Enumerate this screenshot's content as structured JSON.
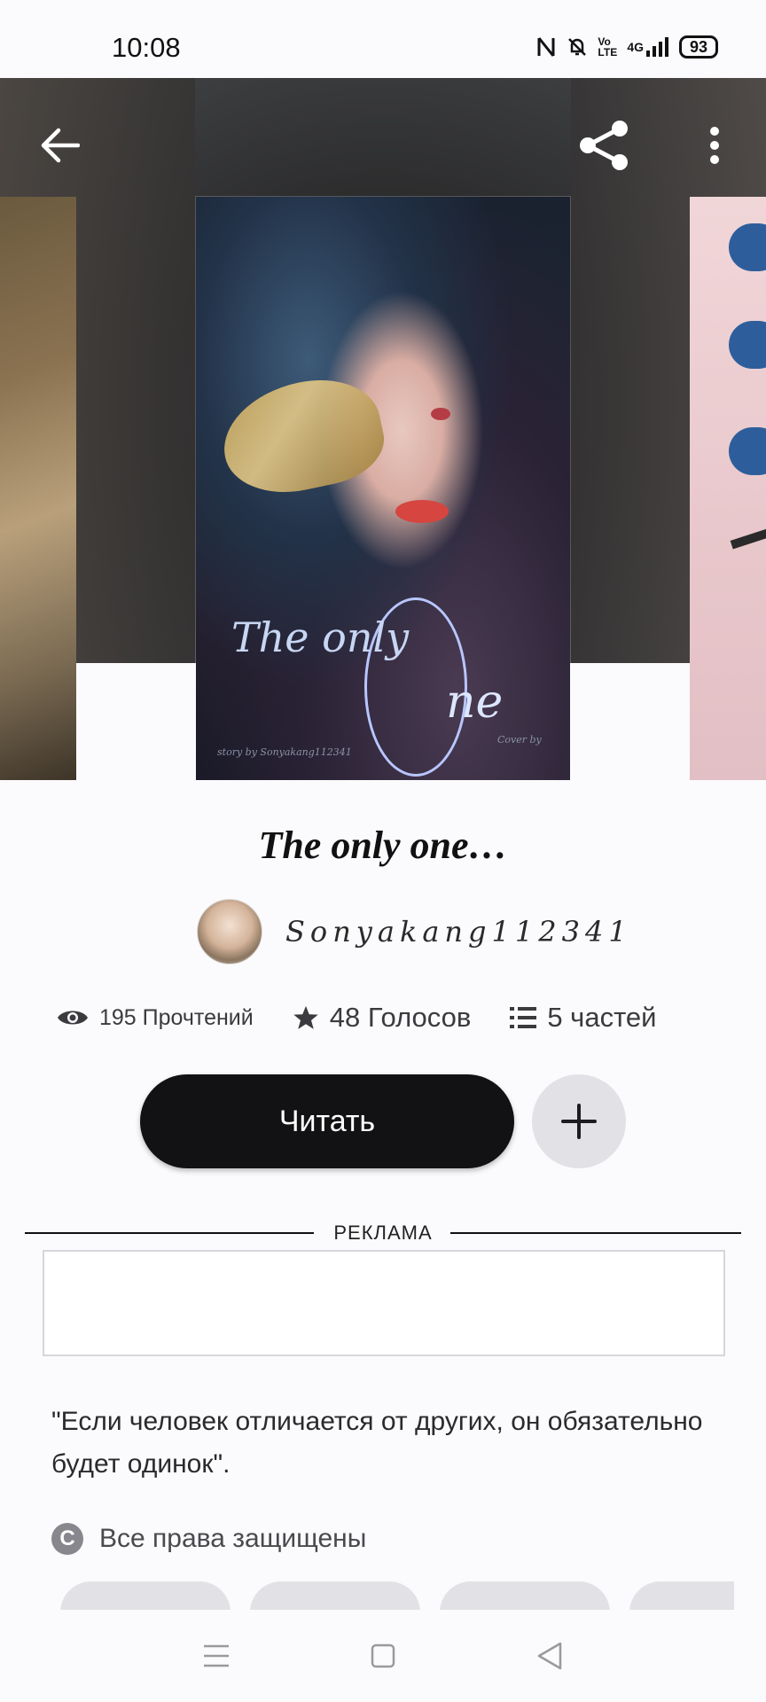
{
  "status_bar": {
    "time": "10:08",
    "icons": [
      "nfc-icon",
      "bell-off-icon",
      "volte-icon",
      "4g-signal-icon"
    ],
    "network": "4G",
    "volte": "Vo LTE",
    "battery": "93"
  },
  "header": {
    "back_icon": "arrow-left-icon",
    "share_icon": "share-icon",
    "menu_icon": "more-vertical-icon"
  },
  "cover": {
    "title_line": "The only",
    "title_one": "ne",
    "credit_left": "story by Sonyakang112341",
    "credit_right": "Cover by"
  },
  "book": {
    "title": "The only one…",
    "author": "Sonyakang112341"
  },
  "stats": {
    "reads": "195 Прочтений",
    "votes": "48 Голосов",
    "parts": "5 частей"
  },
  "actions": {
    "read_label": "Читать",
    "add_icon": "plus-icon"
  },
  "ad": {
    "label": "РЕКЛАМА"
  },
  "description": "\"Если человек отличается от других, он обязательно будет одинок\".",
  "rights": {
    "icon": "copyright-icon",
    "label": "Все права защищены"
  },
  "nav": {
    "menu_icon": "menu-icon",
    "home_icon": "square-icon",
    "back_icon": "triangle-back-icon"
  },
  "colors": {
    "background": "#fbfafc",
    "read_button": "#121113",
    "add_button": "#e2e1e5"
  }
}
